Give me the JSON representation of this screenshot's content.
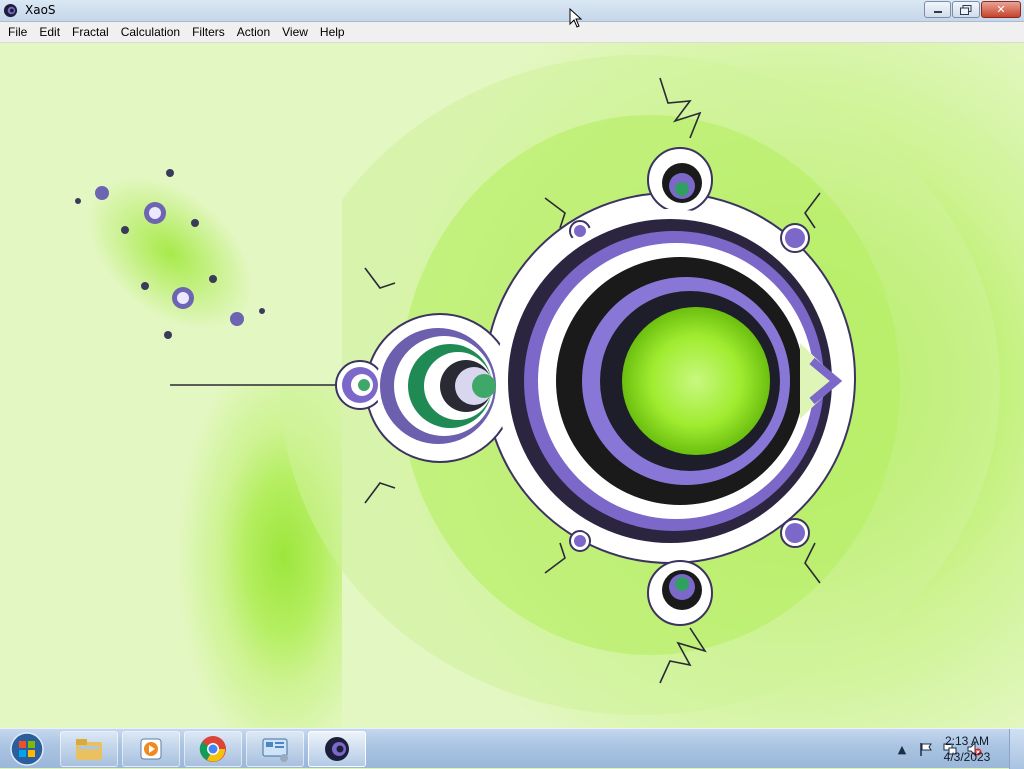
{
  "window": {
    "title": "XaoS",
    "buttons": {
      "minimize": "▭",
      "restore": "❐",
      "close": "✕"
    }
  },
  "menu": {
    "items": [
      "File",
      "Edit",
      "Fractal",
      "Calculation",
      "Filters",
      "Action",
      "View",
      "Help"
    ]
  },
  "canvas": {
    "content": "Mandelbrot set fractal rendering",
    "colors": {
      "background": "#e3f7c2",
      "outer_glow": "#d6f2a6",
      "mid_glow": "#bff07a",
      "inner_glow": "#9de63c",
      "ring_purple": "#7b68c8",
      "ring_dark": "#1a1a1a",
      "center_green": "#a8f03a"
    }
  },
  "taskbar": {
    "start": "start-orb",
    "apps": [
      {
        "name": "windows-explorer-icon"
      },
      {
        "name": "media-player-icon"
      },
      {
        "name": "chrome-icon"
      },
      {
        "name": "control-panel-icon"
      },
      {
        "name": "xaos-icon"
      }
    ],
    "tray": [
      "show-hidden-icons",
      "action-center-flag-icon",
      "network-icon",
      "volume-muted-icon"
    ],
    "clock": {
      "time": "2:13 AM",
      "date": "4/3/2023"
    }
  }
}
